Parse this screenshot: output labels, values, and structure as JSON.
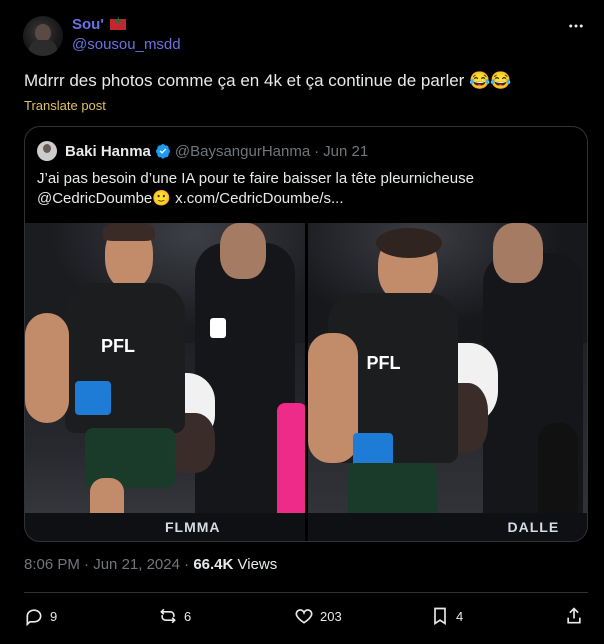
{
  "header": {
    "display_name": "Sou'",
    "handle": "@sousou_msdd",
    "more_icon": "more-horizontal-icon"
  },
  "tweet": {
    "text": "Mdrrr des photos comme ça en 4k et ça continue de parler 😂😂",
    "translate_label": "Translate post"
  },
  "quote": {
    "name": "Baki Hanma",
    "handle": "@BaysangurHanma",
    "separator": "·",
    "date": "Jun 21",
    "text_line1": "J’ai pas besoin d’une IA pour te faire baisser la tête pleurnicheuse",
    "text_line2": "@CedricDoumbe🙂  x.com/CedricDoumbe/s..."
  },
  "meta": {
    "time": "8:06 PM",
    "separator": "·",
    "date": "Jun 21, 2024",
    "separator2": "·",
    "views_count": "66.4K",
    "views_label": "Views"
  },
  "actions": {
    "replies": "9",
    "retweets": "6",
    "likes": "203",
    "bookmarks": "4"
  },
  "colors": {
    "background": "#000000",
    "accent_name": "#6c70e0",
    "translate": "#e0c25f",
    "muted": "#71767b",
    "text": "#e7e9ea",
    "verified": "#1d9bf0"
  },
  "photo_labels": {
    "photo1_canvas": "FLMMA",
    "photo2_canvas": "DALLE"
  }
}
